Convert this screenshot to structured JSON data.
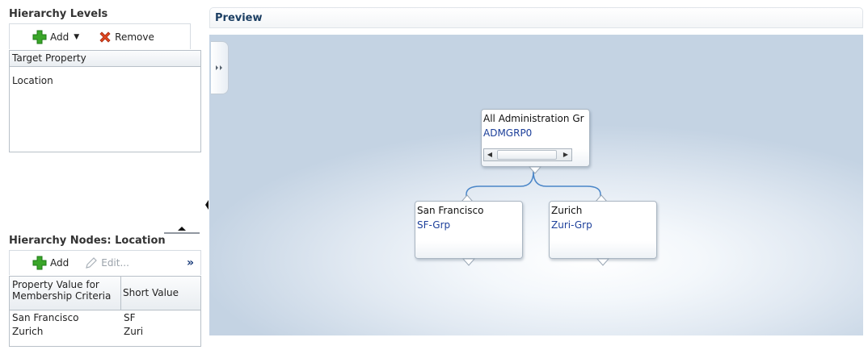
{
  "levels": {
    "title": "Hierarchy Levels",
    "add_label": "Add",
    "remove_label": "Remove",
    "column_header": "Target Property",
    "rows": [
      "Location"
    ]
  },
  "nodes": {
    "title": "Hierarchy Nodes: Location",
    "add_label": "Add",
    "edit_label": "Edit...",
    "more_label": "»",
    "col1": "Property Value for Membership Criteria",
    "col1_line1": "Property Value for",
    "col1_line2": "Membership Criteria",
    "col2": "Short Value",
    "rows": [
      {
        "value": "San Francisco",
        "short": "SF"
      },
      {
        "value": "Zurich",
        "short": "Zuri"
      }
    ]
  },
  "preview": {
    "title": "Preview",
    "root": {
      "label": "All Administration Gr",
      "code": "ADMGRP0"
    },
    "children": [
      {
        "label": "San Francisco",
        "code": "SF-Grp"
      },
      {
        "label": "Zurich",
        "code": "Zuri-Grp"
      }
    ]
  },
  "colors": {
    "title": "#333333",
    "preview_title": "#1c3f63",
    "node_code": "#1c3f9a",
    "connector": "#4a86c8",
    "add_icon": "#3aa629",
    "remove_icon": "#d9361c"
  },
  "icons": [
    "plus-icon",
    "x-icon",
    "dropdown-caret-icon",
    "pencil-icon",
    "double-chevron-icon",
    "collapse-up-icon",
    "collapse-left-icon",
    "expand-panel-icon"
  ]
}
